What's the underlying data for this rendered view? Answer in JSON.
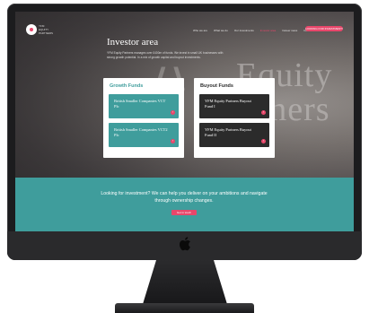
{
  "nav": {
    "logo_text": "YFM EQUITY PARTNERS",
    "items": [
      {
        "label": "Who we are"
      },
      {
        "label": "What we do"
      },
      {
        "label": "Our investments"
      },
      {
        "label": "Investor area"
      },
      {
        "label": "Career news"
      },
      {
        "label": "Contact us"
      }
    ],
    "cta_label": "LOOKING FOR INVESTMENT?"
  },
  "hero": {
    "title": "Investor area",
    "intro": "YFM Equity Partners manages over £400m of funds. We invest in small UK businesses with strong growth potential. In a mix of growth capital and buyout investments."
  },
  "watermark": {
    "line1": "Equity",
    "line2": "rtners"
  },
  "panels": {
    "growth": {
      "title": "Growth Funds",
      "funds": [
        {
          "name": "British Smaller Companies VCT Plc"
        },
        {
          "name": "British Smaller Companies VCT2 Plc"
        }
      ]
    },
    "buyout": {
      "title": "Buyout Funds",
      "funds": [
        {
          "name": "YFM Equity Partners Buyout Fund I"
        },
        {
          "name": "YFM Equity Partners Buyout Fund II"
        }
      ]
    }
  },
  "cta": {
    "text": "Looking for investment? We can help you deliver on your ambitions and navigate through ownership changes.",
    "button_label": "Get in touch"
  },
  "colors": {
    "accent": "#e8476b",
    "teal": "#3f9d9c",
    "dark_tile": "#2b2b2b"
  }
}
